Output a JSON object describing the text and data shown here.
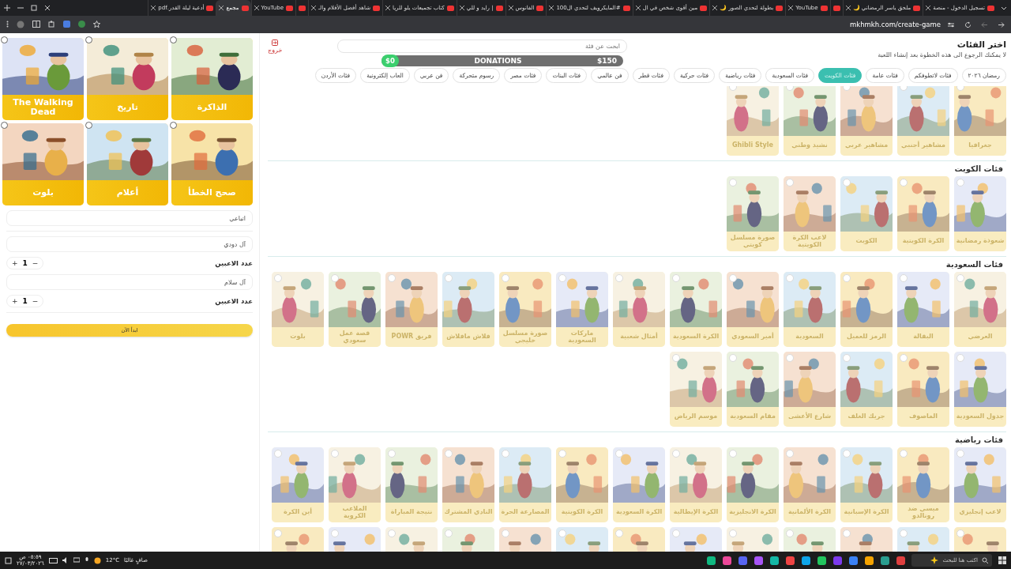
{
  "browser": {
    "tabs": [
      {
        "kind": "page",
        "title": "تسجيل الدخول - منصة",
        "selected": false
      },
      {
        "kind": "page",
        "title": "ملحق ياسر الرمضاني 🌙",
        "selected": false
      },
      {
        "kind": "pinned",
        "selected": false
      },
      {
        "kind": "page",
        "title": "YouTube",
        "selected": false
      },
      {
        "kind": "page",
        "title": "بطولة لتحدي الصور 🌙",
        "selected": false
      },
      {
        "kind": "page",
        "title": "مين أقوى شخص في ال",
        "selected": false
      },
      {
        "kind": "page",
        "title": "#المايكرويف لتحدي ال100",
        "selected": false
      },
      {
        "kind": "page",
        "title": "الفانوس",
        "selected": false
      },
      {
        "kind": "page",
        "title": "| رايد و للي",
        "selected": false
      },
      {
        "kind": "page",
        "title": "كتاب تجميعات يلو للريا",
        "selected": false
      },
      {
        "kind": "page",
        "title": "شاهد أفضل الأفلام والـ",
        "selected": false
      },
      {
        "kind": "pinned",
        "selected": false
      },
      {
        "kind": "page",
        "title": "YouTube",
        "selected": false
      },
      {
        "kind": "page",
        "title": "مجمع",
        "selected": true
      },
      {
        "kind": "page",
        "title": "أدعية ليلة القدر.pdf",
        "selected": false
      }
    ],
    "address": "mkhmkh.com/create-game"
  },
  "page": {
    "logout": "خروج",
    "title": "اختر الفئات",
    "subtitle": "لا يمكنك الرجوع الى هذه الخطوة بعد إنشاء اللعبة",
    "search_placeholder": "ابحث عن فئة",
    "filters": [
      {
        "label": "رمضان ٢٠٢٦",
        "selected": false
      },
      {
        "label": "فئات لاتطوفكم",
        "selected": false
      },
      {
        "label": "فئات عامة",
        "selected": false
      },
      {
        "label": "فئات الكويت",
        "selected": true
      },
      {
        "label": "فئات السعودية",
        "selected": false
      },
      {
        "label": "فئات رياضية",
        "selected": false
      },
      {
        "label": "فئات حركية",
        "selected": false
      },
      {
        "label": "فئات قطر",
        "selected": false
      },
      {
        "label": "فن عالمي",
        "selected": false
      },
      {
        "label": "فئات البنات",
        "selected": false
      },
      {
        "label": "فئات مصر",
        "selected": false
      },
      {
        "label": "رسوم متحركة",
        "selected": false
      },
      {
        "label": "فن عربي",
        "selected": false
      },
      {
        "label": "العاب إلكترونية",
        "selected": false
      },
      {
        "label": "فئات الأردن",
        "selected": false
      }
    ],
    "donations": {
      "label": "DONATIONS",
      "raised": "$0",
      "goal": "$150",
      "level": 0
    }
  },
  "sections": [
    {
      "cards": [
        {
          "label": "جغرافيا"
        },
        {
          "label": "مشاهير أجنبي"
        },
        {
          "label": "مشاهير عربي"
        },
        {
          "label": "نشيد وطني"
        },
        {
          "label": "Ghibli Style"
        }
      ]
    },
    {
      "title": "فئات الكويت",
      "cards": [
        {
          "label": "شعوذة رمضانية"
        },
        {
          "label": "الكرة الكويتية"
        },
        {
          "label": "الكويت"
        },
        {
          "label": "لاعب الكرة الكويتية"
        },
        {
          "label": "صورة مسلسل كويتي"
        }
      ]
    },
    {
      "title": "فئات السعودية",
      "cards": [
        {
          "label": "العرضي"
        },
        {
          "label": "البقالة"
        },
        {
          "label": "الرمز للعميل"
        },
        {
          "label": "السعودية"
        },
        {
          "label": "أمير السعودي"
        },
        {
          "label": "الكرة السعودية"
        },
        {
          "label": "أمثال شعبية"
        },
        {
          "label": "ماركات السعودية"
        },
        {
          "label": "صورة مسلسل خليجي"
        },
        {
          "label": "فلاش مافلاش"
        },
        {
          "label": "فريق POWR"
        },
        {
          "label": "قصة عمل سعودي"
        },
        {
          "label": "بلوت"
        },
        {
          "label": "جدول السعودية"
        },
        {
          "label": "الماصوف"
        },
        {
          "label": "جريك الغلف"
        },
        {
          "label": "شارع الأعشى"
        },
        {
          "label": "مقام السعودية"
        },
        {
          "label": "موسم الرياض"
        }
      ]
    },
    {
      "title": "فئات رياضية",
      "cards": [
        {
          "label": "لاعب إنجليزي"
        },
        {
          "label": "ميسي ضد رونالدو"
        },
        {
          "label": "الكرة الإسبانية"
        },
        {
          "label": "الكرة الألمانية"
        },
        {
          "label": "الكرة الانجليزية"
        },
        {
          "label": "الكرة الإيطالية"
        },
        {
          "label": "الكرة السعودية"
        },
        {
          "label": "الكرة الكويتية"
        },
        {
          "label": "المصارعة الحرة"
        },
        {
          "label": "النادي المشترك"
        },
        {
          "label": "نتيجة المباراة"
        },
        {
          "label": "الملاعب الكروية"
        },
        {
          "label": "أين الكرة"
        }
      ],
      "cards_below": true
    }
  ],
  "side": {
    "chosen": [
      {
        "label": "الذاكرة"
      },
      {
        "label": "تاريخ"
      },
      {
        "label": "The Walking Dead"
      },
      {
        "label": "صحح الخطأ"
      },
      {
        "label": "أعلام"
      },
      {
        "label": "بلوت"
      }
    ],
    "game_name": "اتباعي",
    "teams": [
      {
        "name": "آل دودي",
        "players_label": "عدد الاعبين",
        "plus": "+",
        "count": "1",
        "minus": "−"
      },
      {
        "name": "آل سلام",
        "players_label": "عدد الاعبين",
        "plus": "+",
        "count": "1",
        "minus": "−"
      }
    ],
    "start": "ابدأ الآن"
  },
  "taskbar": {
    "search": "اكتب هنا للبحث",
    "weather": "12°C",
    "condition": "صافٍ غالبًا",
    "time": "٠٥:٥٩ ص",
    "date": "٢٧/٠٣/٢٠٢٦"
  }
}
